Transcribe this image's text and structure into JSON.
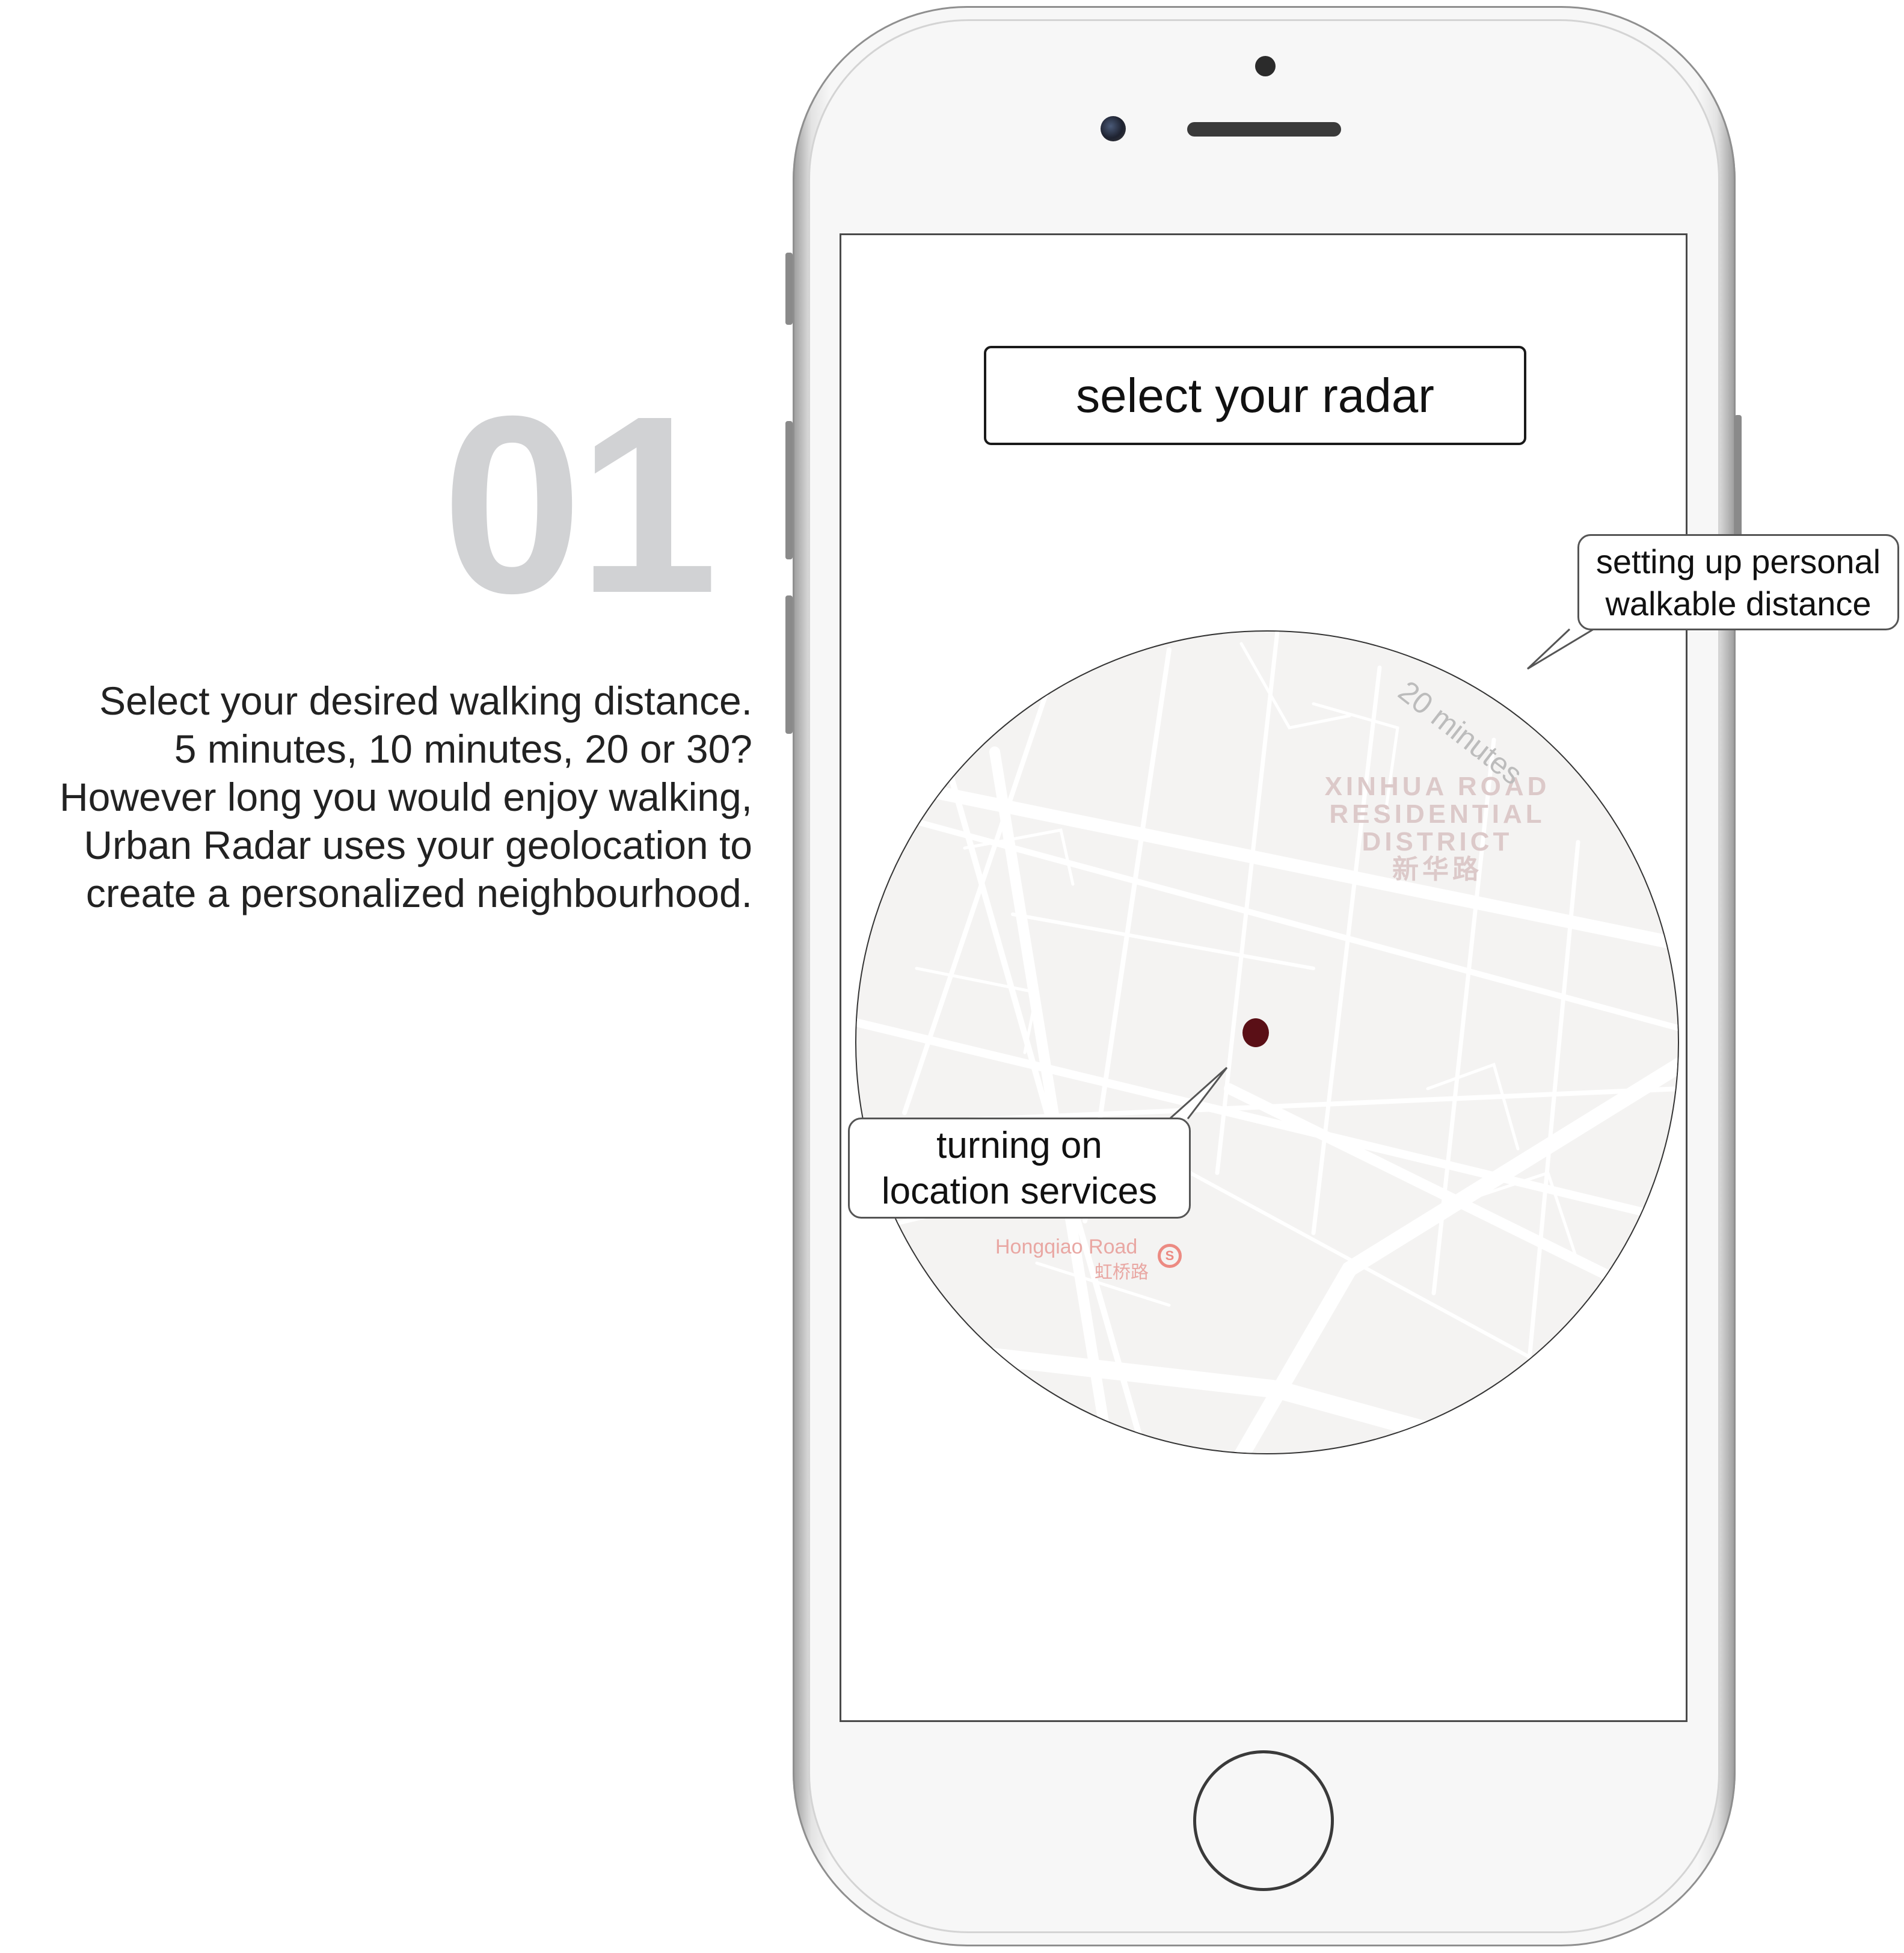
{
  "step": {
    "number": "01"
  },
  "description": {
    "lines": [
      "Select your desired walking distance.",
      "5 minutes, 10 minutes, 20 or 30?",
      "However long you would enjoy walking,",
      "Urban Radar uses your geolocation to",
      "create a personalized neighbourhood."
    ]
  },
  "app": {
    "select_button_label": "select your radar",
    "radar_label": "20 minutes",
    "map": {
      "district_lines": [
        "XINHUA ROAD",
        "RESIDENTIAL",
        "DISTRICT",
        "新华路"
      ],
      "station_name": "Hongqiao Road",
      "station_name_cn": "虹桥路"
    }
  },
  "callouts": {
    "distance": [
      "setting up personal",
      "walkable distance"
    ],
    "location": [
      "turning on",
      "location services"
    ]
  },
  "colors": {
    "step_number": "#d1d2d4",
    "location_dot": "#5a0f16",
    "map_background": "#f4f3f2",
    "station_label": "#e9a7a3"
  },
  "icons": [
    "front-camera-icon",
    "speaker-icon",
    "metro-station-icon",
    "location-pin-icon",
    "home-button-icon"
  ]
}
